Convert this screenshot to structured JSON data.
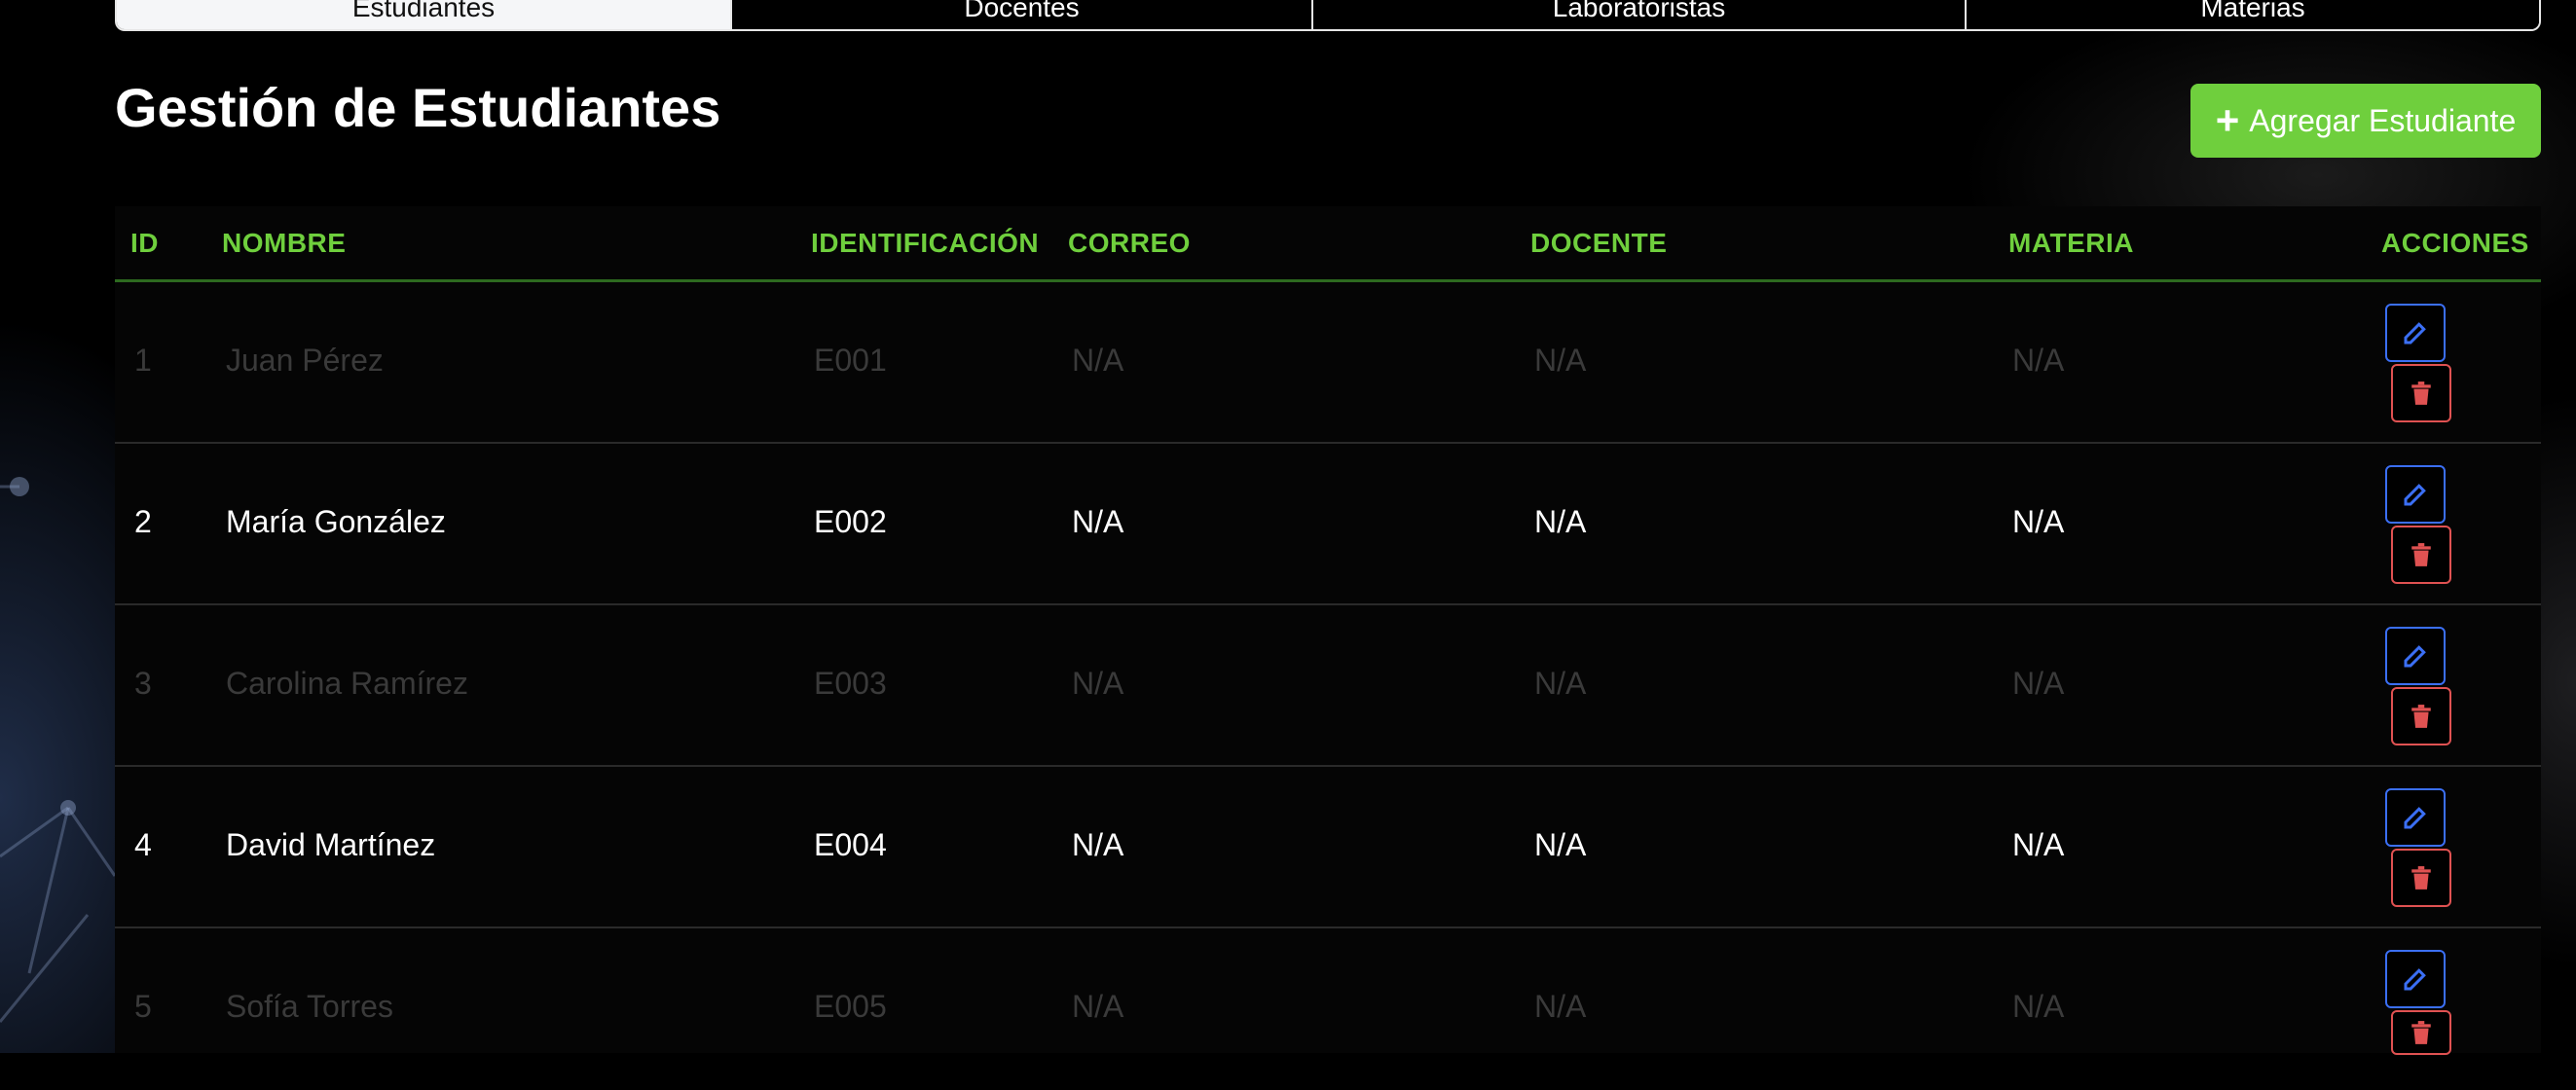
{
  "tabs": [
    "Estudiantes",
    "Docentes",
    "Laboratoristas",
    "Materias"
  ],
  "page_title": "Gestión de Estudiantes",
  "add_button_label": "Agregar Estudiante",
  "columns": [
    "ID",
    "NOMBRE",
    "IDENTIFICACIÓN",
    "CORREO",
    "DOCENTE",
    "MATERIA",
    "ACCIONES"
  ],
  "rows": [
    {
      "id": "1",
      "nombre": "Juan Pérez",
      "identificacion": "E001",
      "correo": "N/A",
      "docente": "N/A",
      "materia": "N/A"
    },
    {
      "id": "2",
      "nombre": "María González",
      "identificacion": "E002",
      "correo": "N/A",
      "docente": "N/A",
      "materia": "N/A"
    },
    {
      "id": "3",
      "nombre": "Carolina Ramírez",
      "identificacion": "E003",
      "correo": "N/A",
      "docente": "N/A",
      "materia": "N/A"
    },
    {
      "id": "4",
      "nombre": "David Martínez",
      "identificacion": "E004",
      "correo": "N/A",
      "docente": "N/A",
      "materia": "N/A"
    },
    {
      "id": "5",
      "nombre": "Sofía Torres",
      "identificacion": "E005",
      "correo": "N/A",
      "docente": "N/A",
      "materia": "N/A"
    }
  ],
  "colors": {
    "accent_green": "#6fcf3d",
    "edit_blue": "#3b6ff5",
    "delete_red": "#e05252",
    "dim_text": "#3a3a3a"
  },
  "icons": {
    "add": "plus-icon",
    "edit": "edit-icon",
    "delete": "trash-icon"
  }
}
